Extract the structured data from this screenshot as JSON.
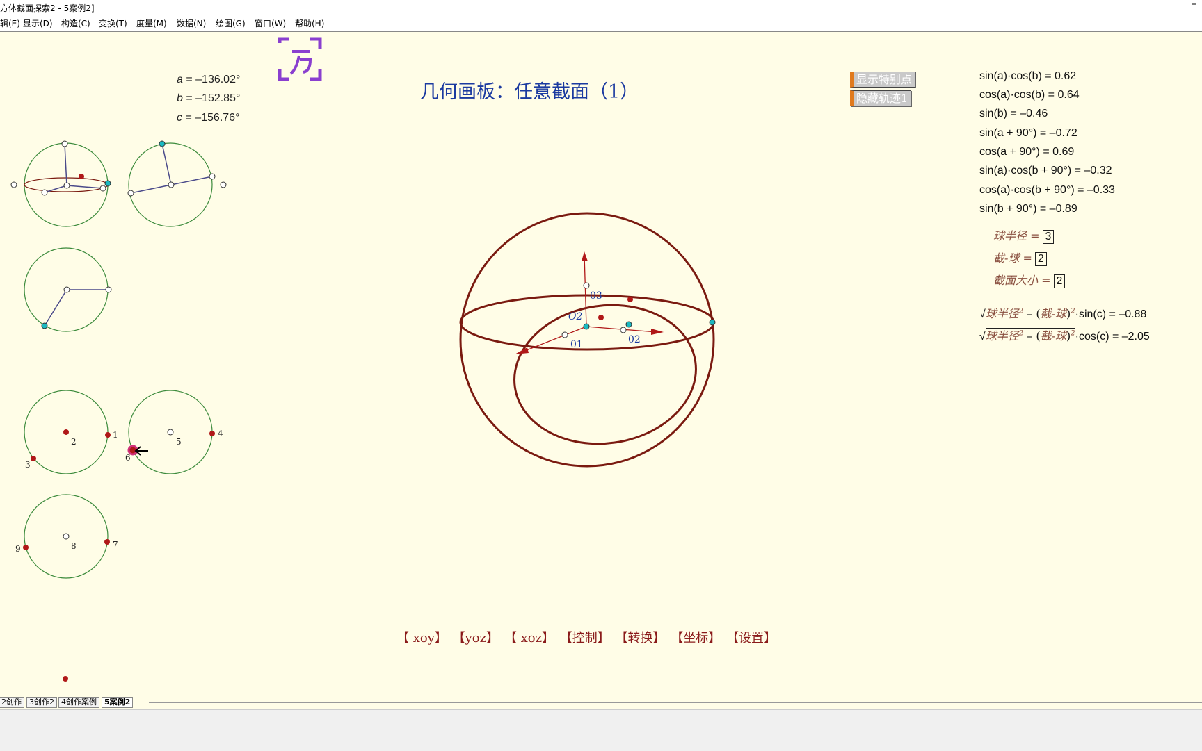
{
  "window": {
    "title": "方体截面探索2 - 5案例2]",
    "minimize": "–"
  },
  "menu": [
    "编辑(E)",
    "显示(D)",
    "构造(C)",
    "变换(T)",
    "度量(M)",
    "数据(N)",
    "绘图(G)",
    "窗口(W)",
    "帮助(H)"
  ],
  "params": {
    "a_name": "a",
    "a_value": " = –136.02°",
    "b_name": "b",
    "b_value": " = –152.85°",
    "c_name": "c",
    "c_value": " = –156.76°"
  },
  "page_title": "几何画板：任意截面（1）",
  "buttons": {
    "show_special": "显示特别点",
    "hide_trace": "隐藏轨迹1"
  },
  "calculations": [
    "sin(a)·cos(b) = 0.62",
    "cos(a)·cos(b) = 0.64",
    "sin(b) = –0.46",
    "sin(a + 90°) = –0.72",
    "cos(a + 90°) = 0.69",
    "sin(a)·cos(b + 90°) = –0.32",
    "cos(a)·cos(b + 90°) = –0.33",
    "sin(b + 90°) = –0.89"
  ],
  "variables": {
    "sphere_radius_label": "球半径 =",
    "sphere_radius_value": "3",
    "section_dist_label": "截-球 =",
    "section_dist_value": "2",
    "section_size_label": "截面大小 =",
    "section_size_value": "2"
  },
  "formulas": {
    "f1_radicand": "球半径",
    "f1_minus": " – (",
    "f1_inner": "截-球",
    "f1_close": ")",
    "f1_tail": "·sin(c) = –0.88",
    "f2_radicand": "球半径",
    "f2_minus": " – (",
    "f2_inner": "截-球",
    "f2_close": ")",
    "f2_tail": "·cos(c) = –2.05",
    "sq": "2"
  },
  "diagram_labels": {
    "o1": "01",
    "o2": "02",
    "o3": "03",
    "center": "O2",
    "p1": "1",
    "p2": "2",
    "p3": "3",
    "p4": "4",
    "p5": "5",
    "p6": "6",
    "p7": "7",
    "p8": "8",
    "p9": "9"
  },
  "nav_links": [
    "【 xoy】",
    "【yoz】",
    "【 xoz】",
    "【控制】",
    "【转换】",
    "【坐标】",
    "【设置】"
  ],
  "tabs": [
    "2创作",
    "3创作2",
    "4创作案例",
    "5案例2"
  ],
  "active_tab": "5案例2",
  "colors": {
    "canvas_bg": "#fffde7",
    "sphere": "#7a1a10",
    "circle_green": "#3b8a3b",
    "point_red": "#b01818",
    "point_cyan": "#1ab8c0",
    "title_blue": "#1b3aa0",
    "logo_purple": "#8a3fcf"
  }
}
